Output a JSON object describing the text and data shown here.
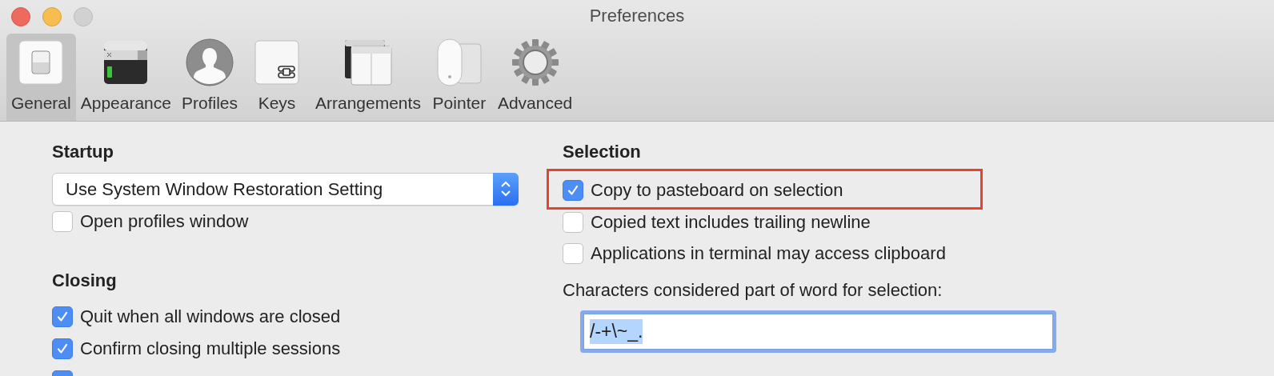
{
  "window": {
    "title": "Preferences"
  },
  "tabs": [
    {
      "label": "General",
      "selected": true
    },
    {
      "label": "Appearance",
      "selected": false
    },
    {
      "label": "Profiles",
      "selected": false
    },
    {
      "label": "Keys",
      "selected": false
    },
    {
      "label": "Arrangements",
      "selected": false
    },
    {
      "label": "Pointer",
      "selected": false
    },
    {
      "label": "Advanced",
      "selected": false
    }
  ],
  "startup": {
    "heading": "Startup",
    "popup": {
      "value": "Use System Window Restoration Setting"
    },
    "options": [
      {
        "label": "Open profiles window",
        "checked": false
      }
    ]
  },
  "closing": {
    "heading": "Closing",
    "options": [
      {
        "label": "Quit when all windows are closed",
        "checked": true
      },
      {
        "label": "Confirm closing multiple sessions",
        "checked": true
      },
      {
        "checked": true
      }
    ]
  },
  "selection": {
    "heading": "Selection",
    "options": [
      {
        "label": "Copy to pasteboard on selection",
        "checked": true,
        "highlighted": true
      },
      {
        "label": "Copied text includes trailing newline",
        "checked": false,
        "highlighted": false
      },
      {
        "label": "Applications in terminal may access clipboard",
        "checked": false,
        "highlighted": false
      }
    ],
    "word_chars": {
      "label": "Characters considered part of word for selection:",
      "value": "/-+\\~_.",
      "text_selected": true
    }
  }
}
